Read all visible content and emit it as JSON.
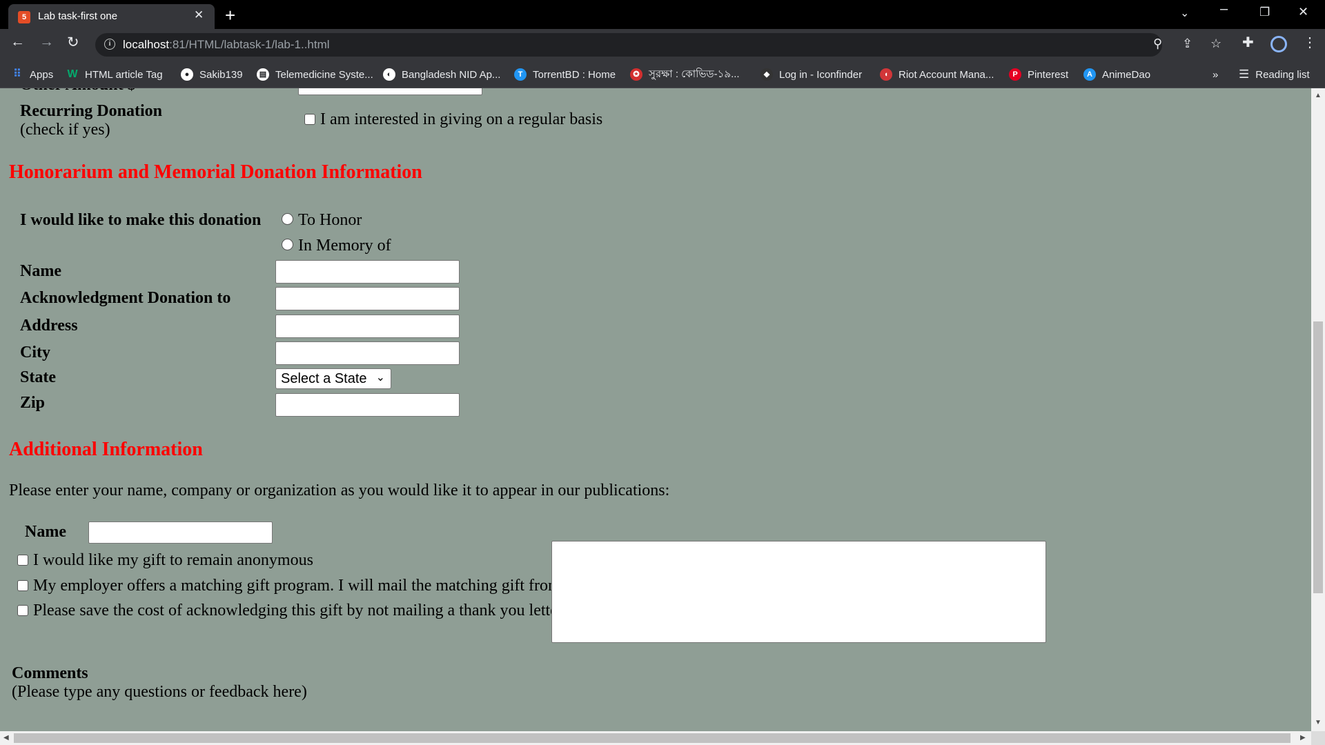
{
  "browser": {
    "tab_title": "Lab task-first one",
    "tab_favicon": "5",
    "url_host": "localhost",
    "url_rest": ":81/HTML/labtask-1/lab-1..html",
    "bookmarks": [
      {
        "label": "Apps",
        "icon": "apps-grid-icon",
        "color": "#4285f4"
      },
      {
        "label": "HTML article Tag",
        "icon": "w3-icon",
        "color": "#04aa6d"
      },
      {
        "label": "Sakib139",
        "icon": "github-icon",
        "color": "#ffffff"
      },
      {
        "label": "Telemedicine Syste...",
        "icon": "document-icon",
        "color": "#ffffff"
      },
      {
        "label": "Bangladesh NID Ap...",
        "icon": "globe-icon",
        "color": "#ffffff"
      },
      {
        "label": "TorrentBD : Home",
        "icon": "torrentbd-icon",
        "color": "#2196f3"
      },
      {
        "label": "সুরক্ষা : কোভিড-১৯...",
        "icon": "bd-gov-icon",
        "color": "#d32f2f"
      },
      {
        "label": "Log in - Iconfinder",
        "icon": "iconfinder-icon",
        "color": "#333333"
      },
      {
        "label": "Riot Account Mana...",
        "icon": "riot-icon",
        "color": "#d13639"
      },
      {
        "label": "Pinterest",
        "icon": "pinterest-icon",
        "color": "#e60023"
      },
      {
        "label": "AnimeDao",
        "icon": "animedao-icon",
        "color": "#2196f3"
      }
    ],
    "overflow_label": "»",
    "reading_list": "Reading list"
  },
  "form": {
    "cut_off_label": "Other Amount $",
    "recurring_label": "Recurring Donation",
    "recurring_sub": "(check if yes)",
    "recurring_checkbox": "I am interested in giving on a regular basis",
    "honorarium_heading": "Honorarium and Memorial Donation Information",
    "donation_label": "I would like to make this donation",
    "radio_honor": "To Honor",
    "radio_memory": "In Memory of",
    "name_label": "Name",
    "ack_label": "Acknowledgment Donation to",
    "address_label": "Address",
    "city_label": "City",
    "state_label": "State",
    "state_select": "Select a State",
    "zip_label": "Zip",
    "additional_heading": "Additional Information",
    "additional_text": "Please enter your name, company or organization as you would like it to appear in our publications:",
    "pub_name_label": "Name",
    "cb_anonymous": "I would like my gift to remain anonymous",
    "cb_employer": "My employer offers a matching gift program. I will mail the matching gift from.",
    "cb_save_cost": "Please save the cost of acknowledging this gift by not mailing a thank you letter.",
    "comments_label": "Comments",
    "comments_sub": "(Please type any questions or feedback here)"
  }
}
